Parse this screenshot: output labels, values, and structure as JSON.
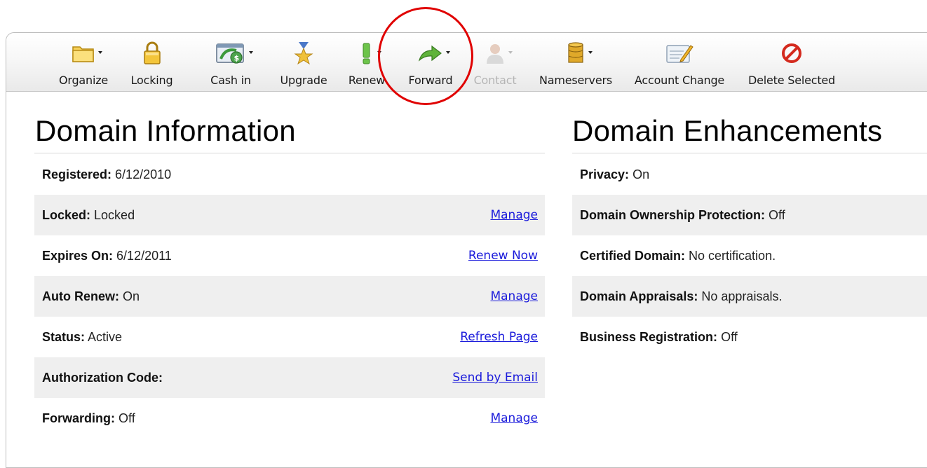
{
  "toolbar": {
    "items": [
      {
        "label": "Organize",
        "icon": "folder-icon"
      },
      {
        "label": "Locking",
        "icon": "lock-icon"
      },
      {
        "label": "Cash in",
        "icon": "cash-in-icon"
      },
      {
        "label": "Upgrade",
        "icon": "upgrade-medal-icon"
      },
      {
        "label": "Renew",
        "icon": "renew-exclamation-icon"
      },
      {
        "label": "Forward",
        "icon": "forward-arrow-icon"
      },
      {
        "label": "Contact",
        "icon": "contact-person-icon",
        "disabled": true
      },
      {
        "label": "Nameservers",
        "icon": "nameservers-database-icon"
      },
      {
        "label": "Account Change",
        "icon": "account-change-icon"
      },
      {
        "label": "Delete Selected",
        "icon": "delete-icon"
      }
    ]
  },
  "domain_information": {
    "title": "Domain Information",
    "rows": [
      {
        "label": "Registered:",
        "value": "6/12/2010",
        "link": ""
      },
      {
        "label": "Locked:",
        "value": "Locked",
        "link": "Manage"
      },
      {
        "label": "Expires On:",
        "value": "6/12/2011",
        "link": "Renew Now"
      },
      {
        "label": "Auto Renew:",
        "value": "On",
        "link": "Manage"
      },
      {
        "label": "Status:",
        "value": "Active",
        "link": "Refresh Page"
      },
      {
        "label": "Authorization Code:",
        "value": "",
        "link": "Send by Email"
      },
      {
        "label": "Forwarding:",
        "value": "Off",
        "link": "Manage"
      }
    ]
  },
  "domain_enhancements": {
    "title": "Domain Enhancements",
    "rows": [
      {
        "label": "Privacy:",
        "value": "On"
      },
      {
        "label": "Domain Ownership Protection:",
        "value": "Off"
      },
      {
        "label": "Certified Domain:",
        "value": "No certification."
      },
      {
        "label": "Domain Appraisals:",
        "value": "No appraisals."
      },
      {
        "label": "Business Registration:",
        "value": "Off"
      }
    ]
  },
  "colors": {
    "link": "#1a1adb",
    "row_shade": "#efefef",
    "highlight_circle": "#e00000",
    "disabled_text": "#b5b5b5"
  }
}
